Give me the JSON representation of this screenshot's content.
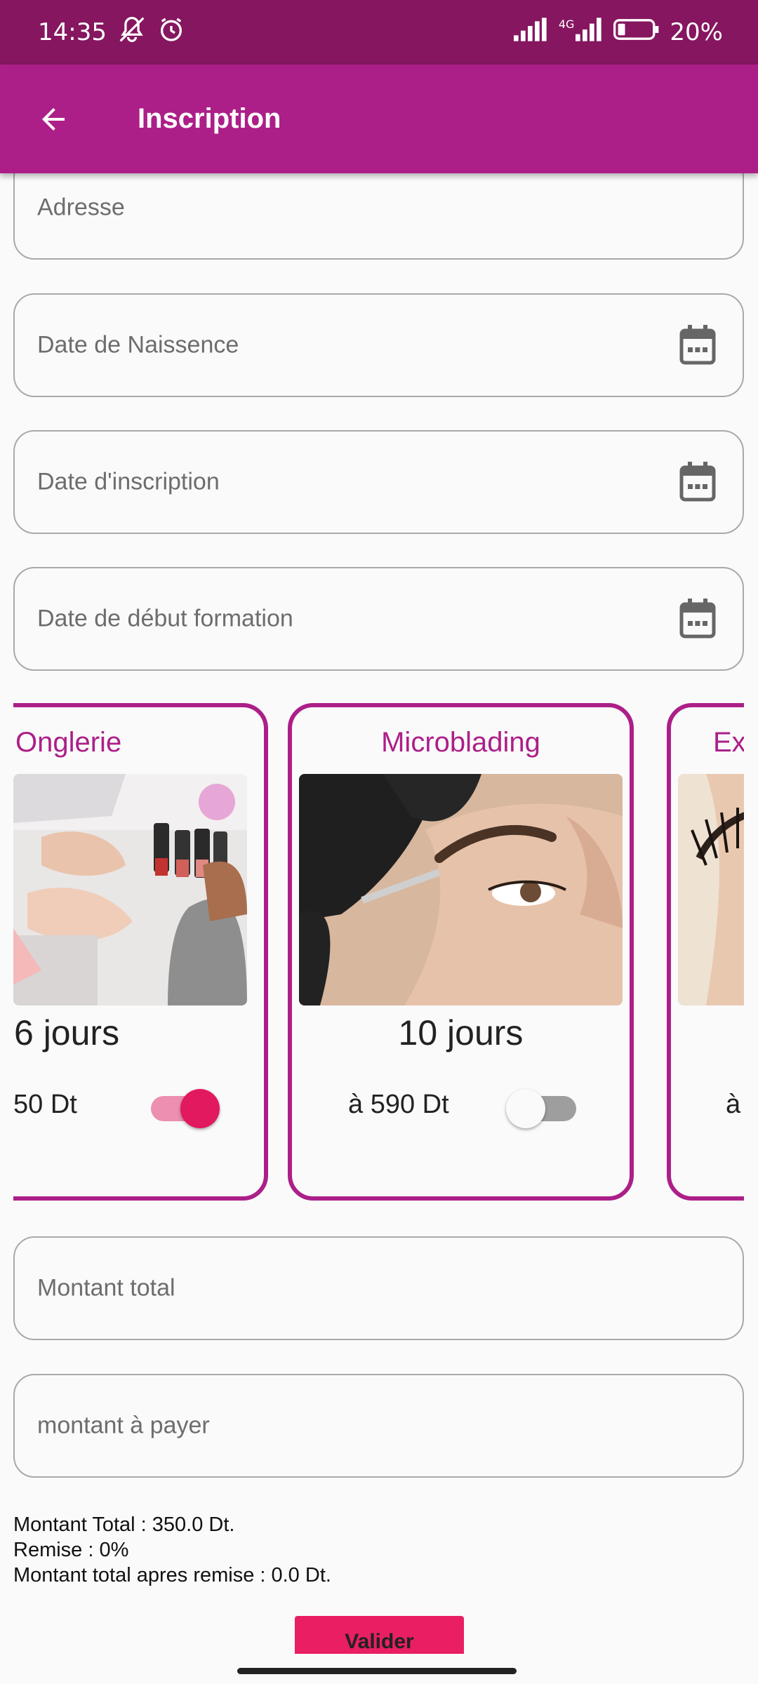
{
  "statusbar": {
    "time": "14:35",
    "network": "4G",
    "battery": "20%"
  },
  "appbar": {
    "title": "Inscription"
  },
  "fields": {
    "adresse": "Adresse",
    "date_naissance": "Date de Naissence",
    "date_inscription": "Date d'inscription",
    "date_debut": "Date de début formation",
    "montant_total": "Montant total",
    "montant_payer": "montant à payer"
  },
  "cards": [
    {
      "title": "Onglerie",
      "days": "6 jours",
      "price": "50 Dt",
      "selected": true,
      "image": "nail-manicure-photo"
    },
    {
      "title": "Microblading",
      "days": "10 jours",
      "price": "à 590 Dt",
      "selected": false,
      "image": "eyebrow-microblading-photo"
    },
    {
      "title": "Ex",
      "days": "",
      "price": "à",
      "selected": false,
      "image": "eyelash-extension-photo"
    }
  ],
  "summary": {
    "line1": "Montant Total : 350.0 Dt.",
    "line2": "Remise : 0%",
    "line3": "Montant total apres remise : 0.0 Dt."
  },
  "actions": {
    "valider": "Valider"
  },
  "colors": {
    "primary": "#ac1f88",
    "statusbar": "#85165f",
    "accent": "#e91e63"
  }
}
